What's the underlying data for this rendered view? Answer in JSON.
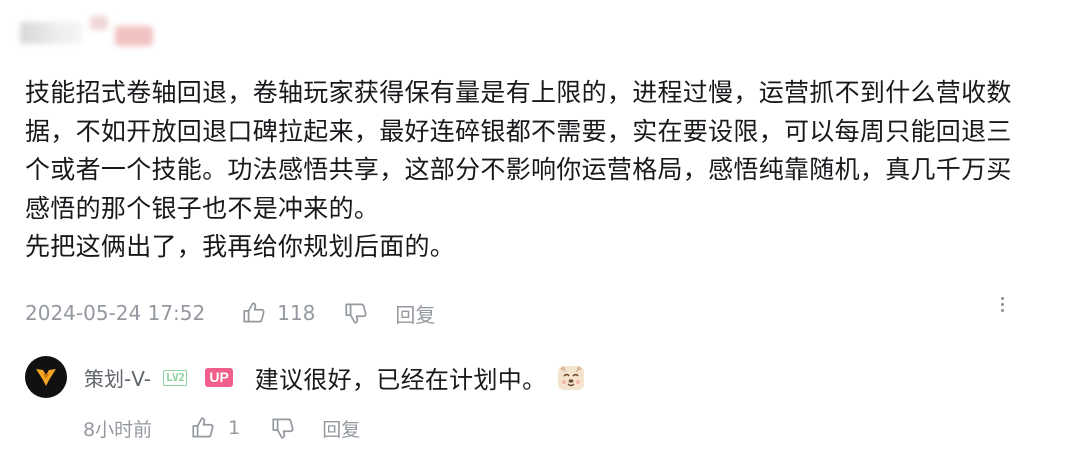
{
  "comment": {
    "username_blurred": true,
    "text": "技能招式卷轴回退，卷轴玩家获得保有量是有上限的，进程过慢，运营抓不到什么营收数\n据，不如开放回退口碑拉起来，最好连碎银都不需要，实在要设限，可以每周只能回退三\n个或者一个技能。功法感悟共享，这部分不影响你运营格局，感悟纯靠随机，真几千万买\n感悟的那个银子也不是冲来的。\n先把这俩出了，我再给你规划后面的。",
    "timestamp": "2024-05-24 17:52",
    "like_count": "118",
    "reply_label": "回复",
    "icons": {
      "like": "thumbs-up-icon",
      "dislike": "thumbs-down-icon",
      "more": "more-vertical-icon"
    }
  },
  "reply": {
    "username": "策划-V-",
    "level_badge": "LV2",
    "up_badge": "UP",
    "text": "建议很好，已经在计划中。",
    "emoji": "dog-face-emoji",
    "timestamp": "8小时前",
    "like_count": "1",
    "reply_label": "回复"
  },
  "colors": {
    "text_primary": "#18191c",
    "text_meta": "#9499a0",
    "level_badge": "#8bd29b",
    "up_badge": "#f05e8c",
    "avatar_bg": "#111111",
    "avatar_logo": "#f6a623"
  }
}
